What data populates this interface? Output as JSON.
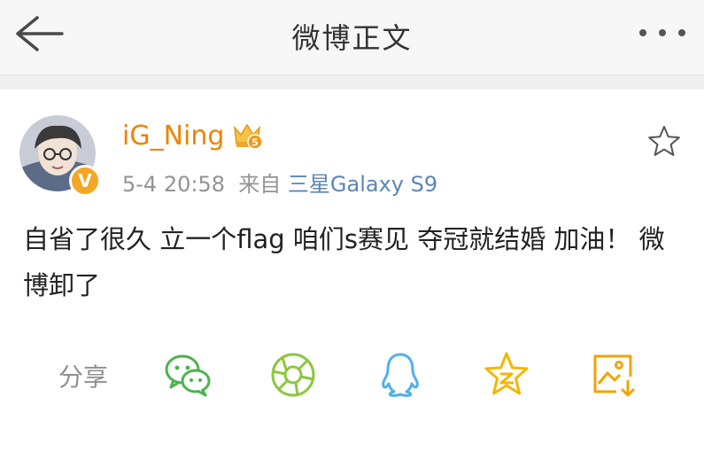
{
  "header": {
    "title": "微博正文",
    "back_icon": "back-arrow-icon",
    "more_icon": "more-dots-icon"
  },
  "post": {
    "username": "iG_Ning",
    "crown_badge_level": "5",
    "verified_badge": "V",
    "timestamp": "5-4 20:58",
    "source_prefix": "来自",
    "source_device": "三星Galaxy S9",
    "content": "自省了很久 立一个flag 咱们s赛见 夺冠就结婚 加油！ 微博卸了"
  },
  "share": {
    "label": "分享",
    "targets": [
      {
        "name": "wechat-icon",
        "color": "#4cb34c"
      },
      {
        "name": "moments-icon",
        "color": "#8dc63f"
      },
      {
        "name": "qq-icon",
        "color": "#4fb0e8"
      },
      {
        "name": "qzone-icon",
        "color": "#f7b500"
      },
      {
        "name": "save-image-icon",
        "color": "#f0a500"
      }
    ]
  },
  "colors": {
    "username": "#f08200",
    "source_device": "#5b86b5",
    "meta": "#939393"
  }
}
